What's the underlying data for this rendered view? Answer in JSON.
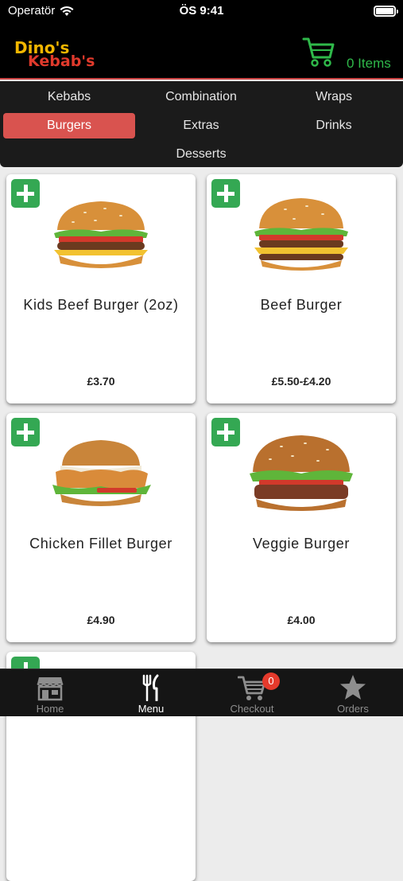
{
  "status_bar": {
    "carrier": "Operatör",
    "time": "ÖS 9:41"
  },
  "header": {
    "logo_line1": "Dino's",
    "logo_line2": "Kebab's",
    "cart_count_label": "0 Items",
    "accent_color": "#2fb94a"
  },
  "categories": [
    {
      "label": "Kebabs",
      "active": false
    },
    {
      "label": "Combination",
      "active": false
    },
    {
      "label": "Wraps",
      "active": false
    },
    {
      "label": "Burgers",
      "active": true
    },
    {
      "label": "Extras",
      "active": false
    },
    {
      "label": "Drinks",
      "active": false
    },
    {
      "label": "Desserts",
      "active": false
    }
  ],
  "products": [
    {
      "name": "Kids Beef Burger (2oz)",
      "price": "£3.70",
      "icon": "burger-image"
    },
    {
      "name": "Beef Burger",
      "price": "£5.50-£4.20",
      "icon": "burger-image"
    },
    {
      "name": "Chicken Fillet Burger",
      "price": "£4.90",
      "icon": "chicken-burger-image"
    },
    {
      "name": "Veggie Burger",
      "price": "£4.00",
      "icon": "veggie-burger-image"
    }
  ],
  "tabbar": {
    "tabs": [
      {
        "label": "Home",
        "icon": "store-icon",
        "active": false
      },
      {
        "label": "Menu",
        "icon": "fork-knife-icon",
        "active": true
      },
      {
        "label": "Checkout",
        "icon": "cart-icon",
        "active": false
      },
      {
        "label": "Orders",
        "icon": "star-icon",
        "active": false
      }
    ],
    "checkout_badge": "0"
  },
  "colors": {
    "active_category": "#d9534f",
    "add_button": "#34a853",
    "badge": "#e53a2c"
  }
}
